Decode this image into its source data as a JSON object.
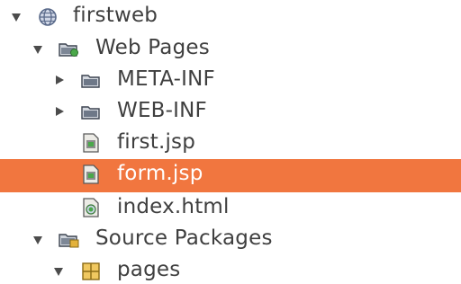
{
  "tree": {
    "items": [
      {
        "label": "firstweb",
        "icon": "globe-icon"
      },
      {
        "label": "Web Pages",
        "icon": "web-pages-folder-icon"
      },
      {
        "label": "META-INF",
        "icon": "folder-icon"
      },
      {
        "label": "WEB-INF",
        "icon": "folder-icon"
      },
      {
        "label": "first.jsp",
        "icon": "jsp-file-icon"
      },
      {
        "label": "form.jsp",
        "icon": "jsp-file-icon",
        "selected": true
      },
      {
        "label": "index.html",
        "icon": "html-file-icon"
      },
      {
        "label": "Source Packages",
        "icon": "source-packages-icon"
      },
      {
        "label": "pages",
        "icon": "package-icon"
      }
    ]
  },
  "colors": {
    "selection": "#f1763f",
    "text": "#3f3f3f"
  }
}
